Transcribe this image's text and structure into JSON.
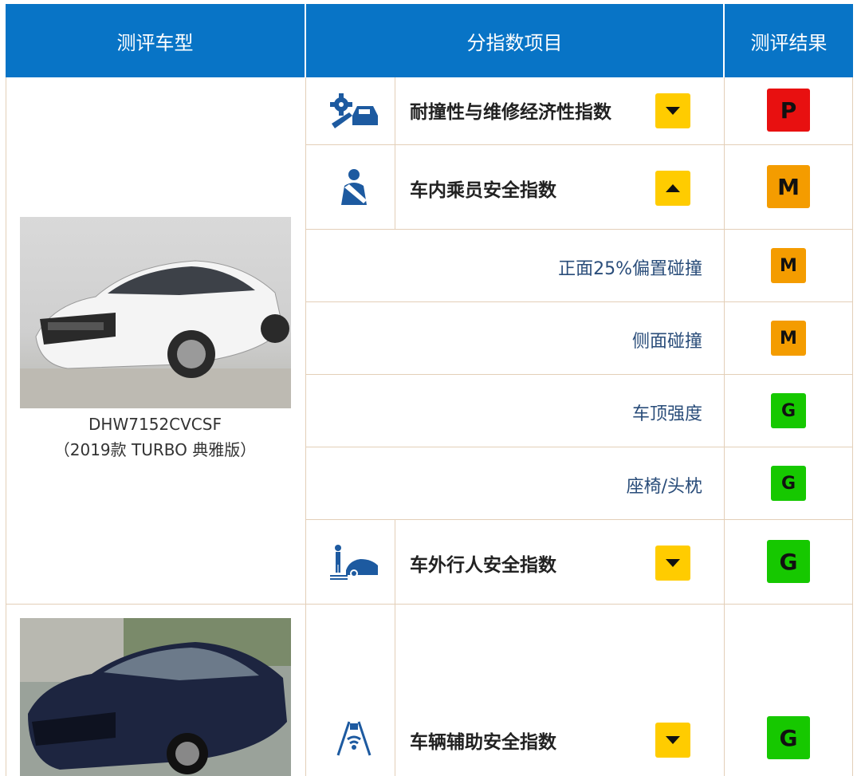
{
  "header": {
    "col_model": "测评车型",
    "col_index": "分指数项目",
    "col_result": "测评结果"
  },
  "car1": {
    "model_code": "DHW7152CVCSF",
    "edition": "（2019款 TURBO 典雅版）",
    "image_icon": "white-sedan-photo"
  },
  "car2": {
    "image_icon": "dark-blue-sedan-photo"
  },
  "indices": [
    {
      "label": "耐撞性与维修经济性指数",
      "icon": "crash-repair-icon",
      "arrow": "down",
      "result": "P",
      "color": "#e81010"
    },
    {
      "label": "车内乘员安全指数",
      "icon": "occupant-seatbelt-icon",
      "arrow": "up",
      "result": "M",
      "color": "#f49c00"
    },
    {
      "label": "车外行人安全指数",
      "icon": "pedestrian-car-icon",
      "arrow": "down",
      "result": "G",
      "color": "#16c800"
    },
    {
      "label": "车辆辅助安全指数",
      "icon": "assist-road-icon",
      "arrow": "down",
      "result": "G",
      "color": "#16c800"
    }
  ],
  "subitems": [
    {
      "label": "正面25%偏置碰撞",
      "result": "M",
      "color": "#f49c00"
    },
    {
      "label": "侧面碰撞",
      "result": "M",
      "color": "#f49c00"
    },
    {
      "label": "车顶强度",
      "result": "G",
      "color": "#16c800"
    },
    {
      "label": "座椅/头枕",
      "result": "G",
      "color": "#16c800"
    }
  ]
}
